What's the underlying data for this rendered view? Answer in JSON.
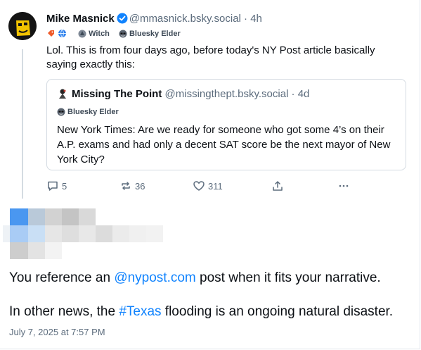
{
  "parent": {
    "name": "Mike Masnick",
    "handle": "@mmasnick.bsky.social",
    "time": "· 4h",
    "badges": {
      "witch": "Witch",
      "elder": "Bluesky Elder"
    },
    "text": "Lol. This is from four days ago, before today's NY Post article basically saying exactly this:",
    "quote": {
      "name": "Missing The Point",
      "handle": "@missingthept.bsky.social",
      "time": "· 4d",
      "badge": "Bluesky Elder",
      "text": "New York Times:  Are we ready for someone who got some 4’s on their A.P. exams and had only a decent SAT score be the next mayor of New York City?"
    },
    "actions": {
      "replies": "5",
      "reposts": "36",
      "likes": "311"
    }
  },
  "reply": {
    "line1": {
      "before": "You reference an ",
      "link": "@nypost.com",
      "after": " post when it fits your narrative."
    },
    "line2": {
      "before": "In other news, the ",
      "link": "#Texas",
      "after": " flooding is an ongoing natural disaster."
    },
    "timestamp": "July 7, 2025 at 7:57 PM"
  },
  "colors": {
    "accent": "#1083fe",
    "muted": "#5b6b7c",
    "border": "#d4dbe2"
  },
  "icons": [
    "verified-icon",
    "emoji-icon",
    "globe-icon",
    "witch-icon",
    "elder-icon",
    "reply-icon",
    "repost-icon",
    "like-icon",
    "share-icon",
    "more-icon"
  ]
}
